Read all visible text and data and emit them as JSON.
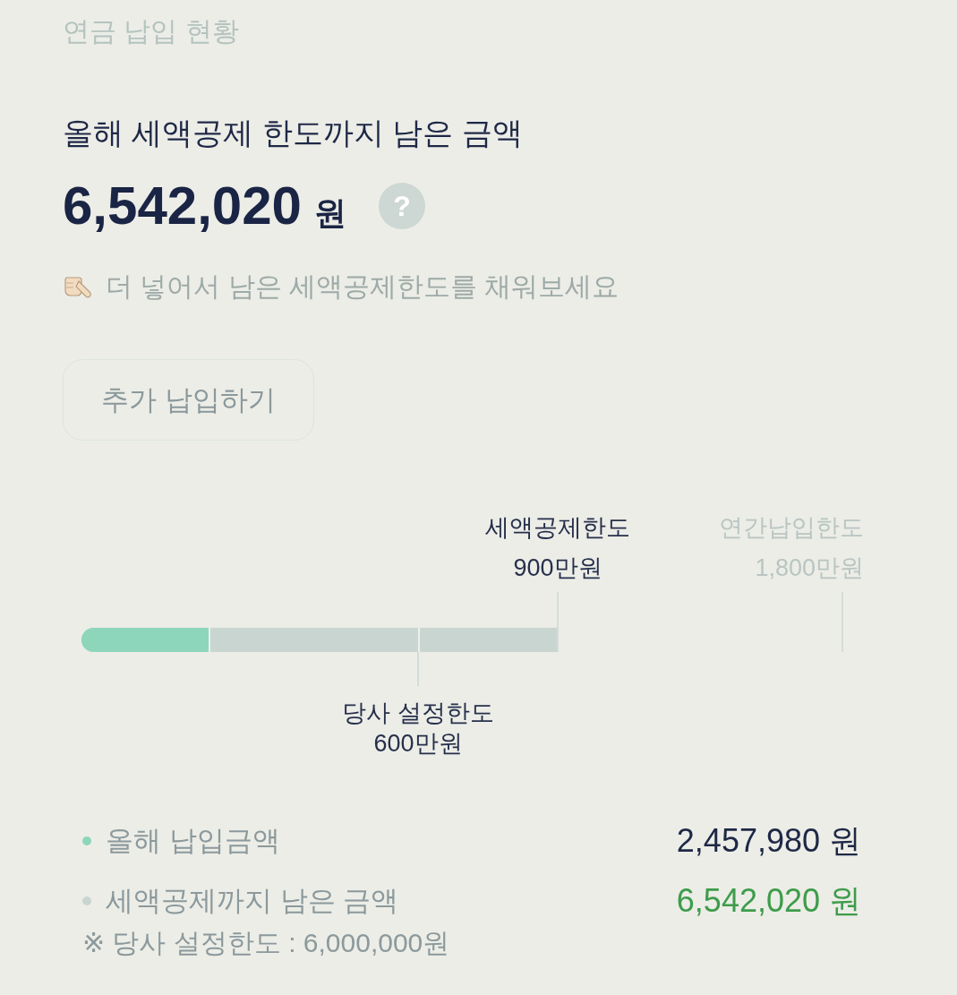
{
  "section_title": "연금 납입 현황",
  "summary": {
    "heading": "올해 세액공제 한도까지 남은 금액",
    "amount": "6,542,020",
    "unit": "원",
    "help": "?"
  },
  "hint": "더 넣어서 남은 세액공제한도를 채워보세요",
  "buttons": [
    {
      "label": "추가 납입하기"
    }
  ],
  "progress": {
    "level": 0.27,
    "markers": [
      {
        "kind": "inside",
        "label": "당사 설정한도",
        "value": "600만원"
      },
      {
        "kind": "end",
        "label": "세액공제한도",
        "value": "900만원"
      },
      {
        "kind": "outside",
        "label": "연간납입한도",
        "value": "1,800만원"
      }
    ]
  },
  "legend": [
    {
      "kind": "paid",
      "label": "올해 납입금액",
      "value": "2,457,980 원",
      "color": "#8dd6bc"
    },
    {
      "kind": "remaining",
      "label": "세액공제까지 남은 금액",
      "value": "6,542,020 원",
      "color": "#c9d5d0"
    }
  ],
  "note": "※ 당사 설정한도 : 6,000,000원"
}
